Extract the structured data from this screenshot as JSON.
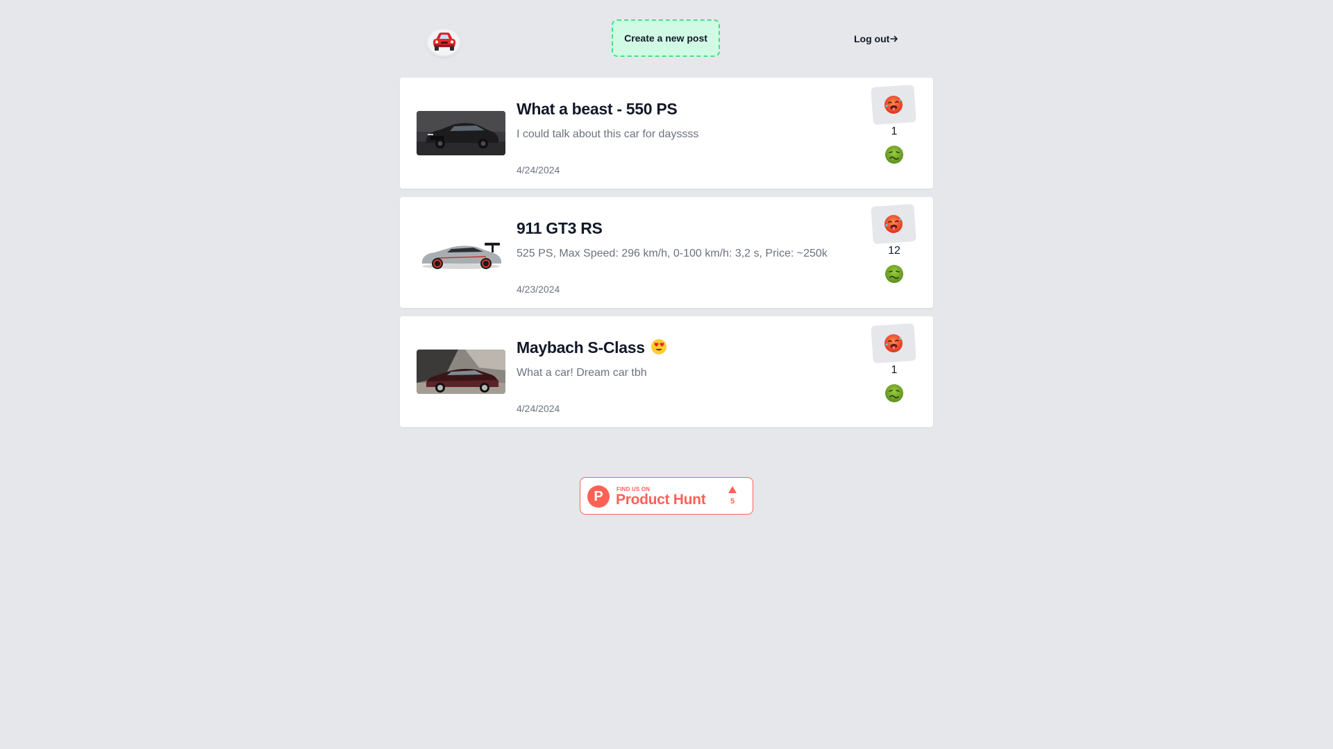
{
  "header": {
    "logo_icon": "car-emoji-icon",
    "create_button_label": "Create a new post",
    "logout_label": "Log out",
    "logout_icon": "arrow-right-icon"
  },
  "posts": [
    {
      "title": "What a beast - 550 PS",
      "title_emoji": "",
      "description": "I could talk about this car for dayssss",
      "date": "4/24/2024",
      "image_icon": "dark-sports-coupe-photo",
      "votes": "1"
    },
    {
      "title": "911 GT3 RS",
      "title_emoji": "",
      "description": "525 PS, Max Speed: 296 km/h, 0-100 km/h: 3,2 s, Price: ~250k",
      "date": "4/23/2024",
      "image_icon": "silver-race-car-photo",
      "votes": "12"
    },
    {
      "title": "Maybach S-Class",
      "title_emoji": "heart-eyes-emoji",
      "description": "What a car! Dream car tbh",
      "date": "4/24/2024",
      "image_icon": "maroon-luxury-sedan-photo",
      "votes": "1"
    }
  ],
  "upvote_icon": "hot-face-emoji-icon",
  "downvote_icon": "nauseated-face-emoji-icon",
  "product_hunt": {
    "small_text": "FIND US ON",
    "big_text": "Product Hunt",
    "logo_letter": "P",
    "upvote_count": "5"
  },
  "colors": {
    "background": "#e5e7eb",
    "create_button_bg": "#d1fae5",
    "create_button_border": "#4ade80",
    "product_hunt": "#ff6154"
  }
}
